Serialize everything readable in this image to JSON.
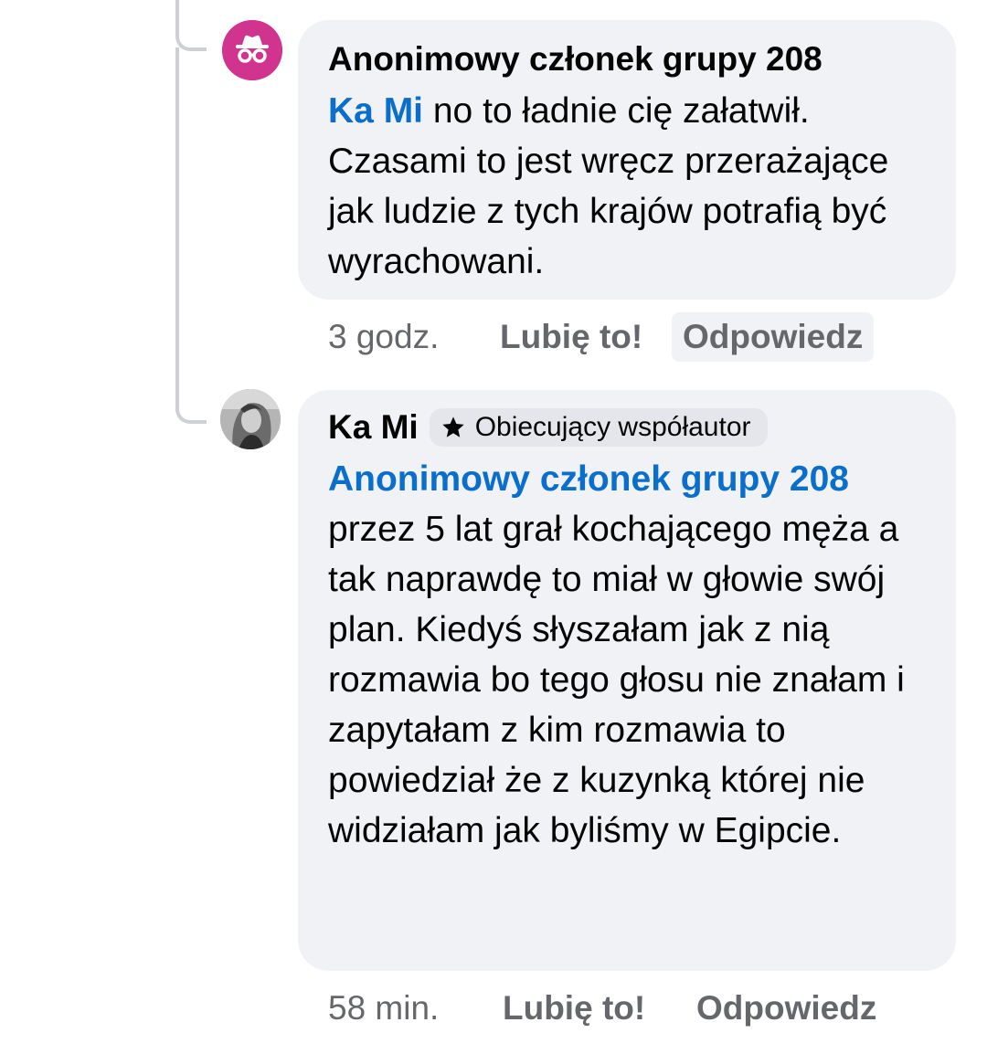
{
  "comments": [
    {
      "author": "Anonimowy członek grupy 208",
      "avatar_icon": "incognito-icon",
      "mention": "Ka Mi",
      "text": " no to ładnie cię załatwił. Czasami to jest wręcz przerażające jak ludzie z tych krajów potrafią być wyrachowani.",
      "time": "3 godz.",
      "like_label": "Lubię to!",
      "reply_label": "Odpowiedz"
    },
    {
      "author": "Ka Mi",
      "avatar_icon": "profile-photo",
      "badge_icon": "star-icon",
      "badge": "Obiecujący współautor",
      "mention": "Anonimowy członek grupy 208",
      "text": "przez 5 lat grał kochającego męża a tak naprawdę to miał w głowie swój plan. Kiedyś słyszałam jak z nią rozmawia bo tego głosu nie znałam i zapytałam z kim rozmawia to powiedział że z kuzynką której nie widziałam jak byliśmy w Egipcie.",
      "time": "58 min.",
      "like_label": "Lubię to!",
      "reply_label": "Odpowiedz"
    }
  ],
  "colors": {
    "mention": "#0a6ecc",
    "bubble": "#f0f2f5",
    "meta": "#65676b",
    "anon_avatar": "#d1348e"
  }
}
